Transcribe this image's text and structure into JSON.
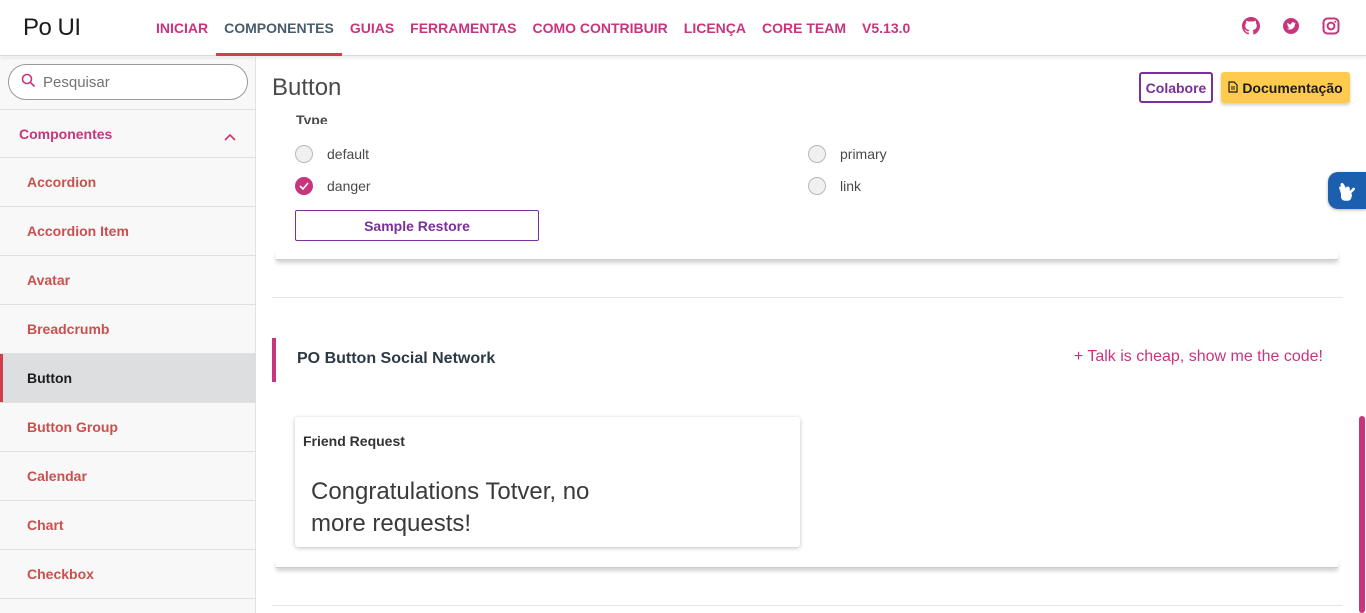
{
  "app": {
    "logo": "Po UI"
  },
  "nav": {
    "items": [
      {
        "label": "INICIAR"
      },
      {
        "label": "COMPONENTES"
      },
      {
        "label": "GUIAS"
      },
      {
        "label": "FERRAMENTAS"
      },
      {
        "label": "COMO CONTRIBUIR"
      },
      {
        "label": "LICENÇA"
      },
      {
        "label": "CORE TEAM"
      },
      {
        "label": "V5.13.0"
      }
    ],
    "active": "COMPONENTES",
    "social": [
      "github-icon",
      "twitter-icon",
      "instagram-icon"
    ]
  },
  "sidebar": {
    "search_placeholder": "Pesquisar",
    "section": "Componentes",
    "items": [
      {
        "label": "Accordion"
      },
      {
        "label": "Accordion Item"
      },
      {
        "label": "Avatar"
      },
      {
        "label": "Breadcrumb"
      },
      {
        "label": "Button"
      },
      {
        "label": "Button Group"
      },
      {
        "label": "Calendar"
      },
      {
        "label": "Chart"
      },
      {
        "label": "Checkbox"
      }
    ],
    "active": "Button"
  },
  "main": {
    "title": "Button",
    "colabore_label": "Colabore",
    "doc_label": "Documentação",
    "type_label": "Type",
    "radios": [
      {
        "label": "default",
        "checked": false
      },
      {
        "label": "primary",
        "checked": false
      },
      {
        "label": "danger",
        "checked": true
      },
      {
        "label": "link",
        "checked": false
      }
    ],
    "sample_restore_label": "Sample Restore",
    "section_title": "PO Button Social Network",
    "show_code_label": "+ Talk is cheap, show me the code!",
    "friend_card": {
      "title": "Friend Request",
      "message": "Congratulations Totver, no more requests!"
    }
  },
  "colors": {
    "accent": "#c9357d",
    "purple": "#7b2f9a",
    "warning": "#ffcb4f",
    "active_bar": "#d13f4b"
  }
}
